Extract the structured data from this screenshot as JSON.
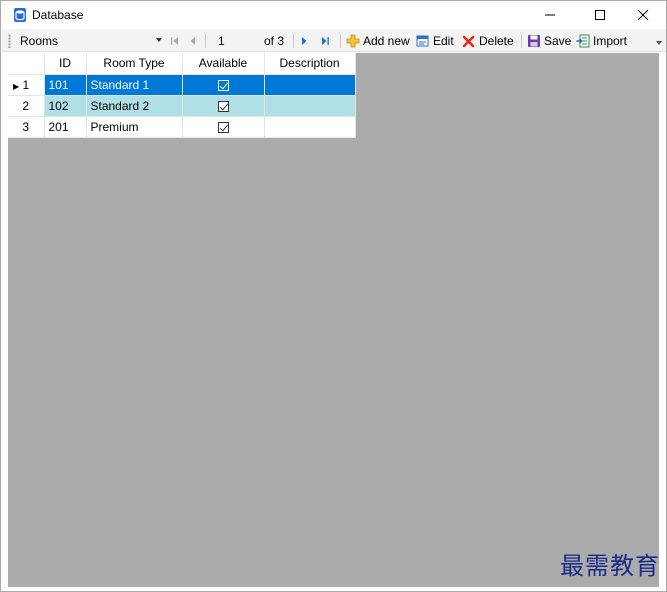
{
  "window": {
    "title": "Database",
    "controls": {
      "minimize": "minimize",
      "maximize": "maximize",
      "close": "close"
    }
  },
  "toolbar": {
    "table_select": "Rooms",
    "position": "1",
    "of_count": "of 3",
    "add_new": "Add new",
    "edit": "Edit",
    "delete": "Delete",
    "save": "Save",
    "import": "Import"
  },
  "grid": {
    "columns": [
      "ID",
      "Room Type",
      "Available",
      "Description"
    ],
    "rows": [
      {
        "row_num": "1",
        "id": "101",
        "room_type": "Standard 1",
        "available": true,
        "description": ""
      },
      {
        "row_num": "2",
        "id": "102",
        "room_type": "Standard 2",
        "available": true,
        "description": ""
      },
      {
        "row_num": "3",
        "id": "201",
        "room_type": "Premium",
        "available": true,
        "description": ""
      }
    ],
    "selected_row": 0
  },
  "watermark": "最需教育",
  "colors": {
    "selection": "#0078d7",
    "alt_row": "#b0e0e6",
    "grid_background": "#ababab"
  }
}
